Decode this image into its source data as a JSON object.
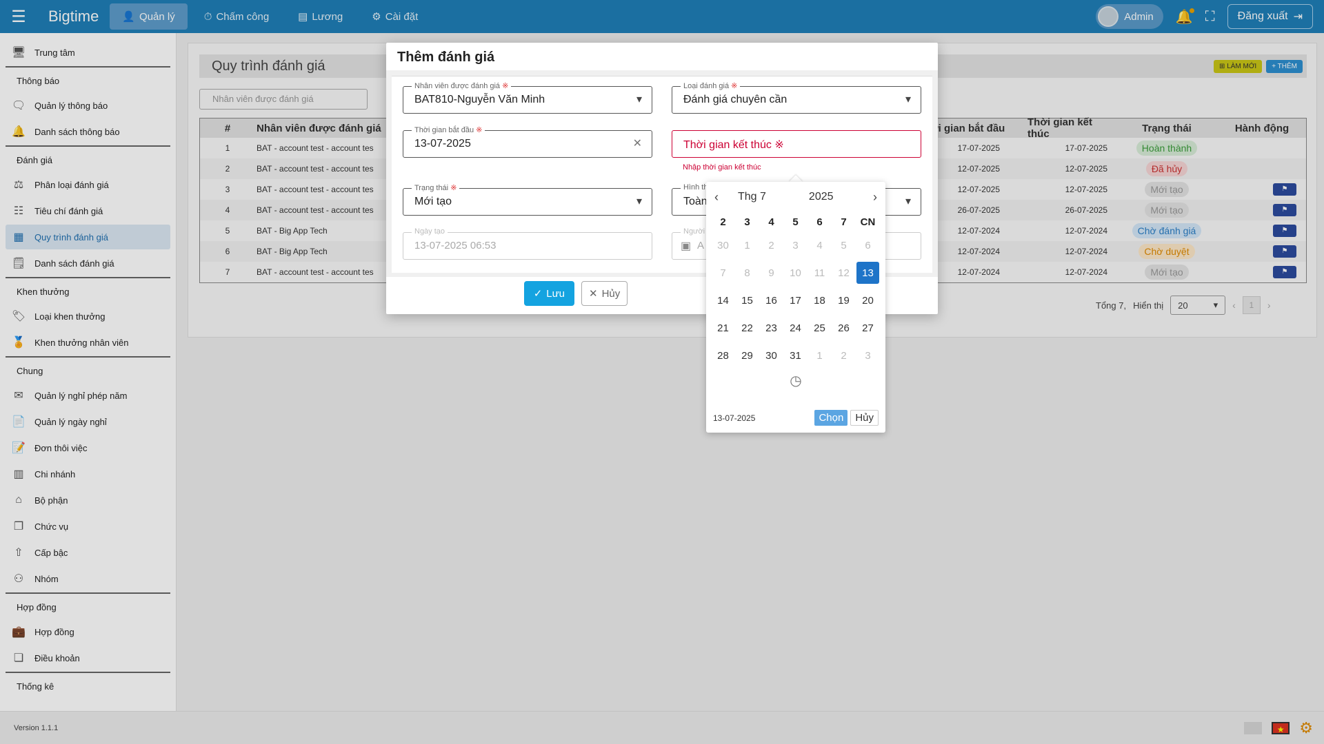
{
  "topbar": {
    "brand": "Bigtime",
    "nav": [
      {
        "label": "Quản lý",
        "icon": "person-icon",
        "active": true
      },
      {
        "label": "Chấm công",
        "icon": "timer-icon",
        "active": false
      },
      {
        "label": "Lương",
        "icon": "document-icon",
        "active": false
      },
      {
        "label": "Cài đặt",
        "icon": "gears-icon",
        "active": false
      }
    ],
    "user": "Admin",
    "logout": "Đăng xuất"
  },
  "sidebar": {
    "top_item": "Trung tâm",
    "groups": [
      {
        "title": "Thông báo",
        "items": [
          "Quản lý thông báo",
          "Danh sách thông báo"
        ]
      },
      {
        "title": "Đánh giá",
        "items": [
          "Phân loại đánh giá",
          "Tiêu chí đánh giá",
          "Quy trình đánh giá",
          "Danh sách đánh giá"
        ]
      },
      {
        "title": "Khen thưởng",
        "items": [
          "Loại khen thưởng",
          "Khen thưởng nhân viên"
        ]
      },
      {
        "title": "Chung",
        "items": [
          "Quản lý nghỉ phép năm",
          "Quản lý ngày nghỉ",
          "Đơn thôi việc",
          "Chi nhánh",
          "Bộ phận",
          "Chức vụ",
          "Cấp bậc",
          "Nhóm"
        ]
      },
      {
        "title": "Hợp đồng",
        "items": [
          "Hợp đồng",
          "Điều khoản"
        ]
      },
      {
        "title": "Thống kê",
        "items": []
      }
    ]
  },
  "page": {
    "title": "Quy trình đánh giá",
    "btn_new": "LÀM MỚI",
    "btn_add": "THÊM",
    "filter_placeholder": "Nhân viên được đánh giá"
  },
  "table": {
    "headers": [
      "#",
      "Nhân viên được đánh giá",
      "ời gian bắt đầu",
      "Thời gian kết thúc",
      "Trạng thái",
      "Hành động"
    ],
    "rows": [
      {
        "idx": "1",
        "name": "BAT - account test - account tes",
        "start": "17-07-2025",
        "end": "17-07-2025",
        "status": "Hoàn thành",
        "kind": "done",
        "action": false
      },
      {
        "idx": "2",
        "name": "BAT - account test - account tes",
        "start": "12-07-2025",
        "end": "12-07-2025",
        "status": "Đã hủy",
        "kind": "cancel",
        "action": false
      },
      {
        "idx": "3",
        "name": "BAT - account test - account tes",
        "start": "12-07-2025",
        "end": "12-07-2025",
        "status": "Mới tạo",
        "kind": "new",
        "action": true
      },
      {
        "idx": "4",
        "name": "BAT - account test - account tes",
        "start": "26-07-2025",
        "end": "26-07-2025",
        "status": "Mới tạo",
        "kind": "new",
        "action": true
      },
      {
        "idx": "5",
        "name": "BAT - Big App Tech",
        "start": "12-07-2024",
        "end": "12-07-2024",
        "status": "Chờ đánh giá",
        "kind": "wait",
        "action": true
      },
      {
        "idx": "6",
        "name": "BAT - Big App Tech",
        "start": "12-07-2024",
        "end": "12-07-2024",
        "status": "Chờ duyệt",
        "kind": "pending",
        "action": true
      },
      {
        "idx": "7",
        "name": "BAT - account test - account tes",
        "start": "12-07-2024",
        "end": "12-07-2024",
        "status": "Mới tạo",
        "kind": "new",
        "action": true
      }
    ]
  },
  "pager": {
    "total": "Tổng 7,",
    "show_label": "Hiển thị",
    "page_size": "20",
    "page": "1"
  },
  "footer": {
    "version": "Version 1.1.1"
  },
  "dialog": {
    "title": "Thêm đánh giá",
    "employee_label": "Nhân viên được đánh giá",
    "employee_value": "BAT810-Nguyễn Văn Minh",
    "type_label": "Loại đánh giá",
    "type_value": "Đánh giá chuyên cần",
    "start_label": "Thời gian bắt đầu",
    "start_value": "13-07-2025",
    "end_placeholder": "Thời gian kết thúc",
    "end_error": "Nhập thời gian kết thúc",
    "status_label": "Trạng thái",
    "status_value": "Mới tạo",
    "form_label": "Hình th",
    "form_value": "Toàn",
    "created_label": "Ngày tạo",
    "created_value": "13-07-2025 06:53",
    "creator_label": "Người",
    "creator_value": "A",
    "required_mark": "※",
    "save": "Lưu",
    "cancel": "Hủy"
  },
  "datepicker": {
    "month": "Thg 7",
    "year": "2025",
    "weekdays": [
      "2",
      "3",
      "4",
      "5",
      "6",
      "7",
      "CN"
    ],
    "weeks": [
      [
        {
          "d": "30",
          "m": true
        },
        {
          "d": "1",
          "m": true
        },
        {
          "d": "2",
          "m": true
        },
        {
          "d": "3",
          "m": true
        },
        {
          "d": "4",
          "m": true
        },
        {
          "d": "5",
          "m": true
        },
        {
          "d": "6",
          "m": true
        }
      ],
      [
        {
          "d": "7",
          "m": true
        },
        {
          "d": "8",
          "m": true
        },
        {
          "d": "9",
          "m": true
        },
        {
          "d": "10",
          "m": true
        },
        {
          "d": "11",
          "m": true
        },
        {
          "d": "12",
          "m": true
        },
        {
          "d": "13",
          "s": true
        }
      ],
      [
        {
          "d": "14"
        },
        {
          "d": "15"
        },
        {
          "d": "16"
        },
        {
          "d": "17"
        },
        {
          "d": "18"
        },
        {
          "d": "19"
        },
        {
          "d": "20"
        }
      ],
      [
        {
          "d": "21"
        },
        {
          "d": "22"
        },
        {
          "d": "23"
        },
        {
          "d": "24"
        },
        {
          "d": "25"
        },
        {
          "d": "26"
        },
        {
          "d": "27"
        }
      ],
      [
        {
          "d": "28"
        },
        {
          "d": "29"
        },
        {
          "d": "30"
        },
        {
          "d": "31"
        },
        {
          "d": "1",
          "m": true
        },
        {
          "d": "2",
          "m": true
        },
        {
          "d": "3",
          "m": true
        }
      ]
    ],
    "selected_text": "13-07-2025",
    "ok": "Chọn",
    "cancel": "Hủy"
  }
}
